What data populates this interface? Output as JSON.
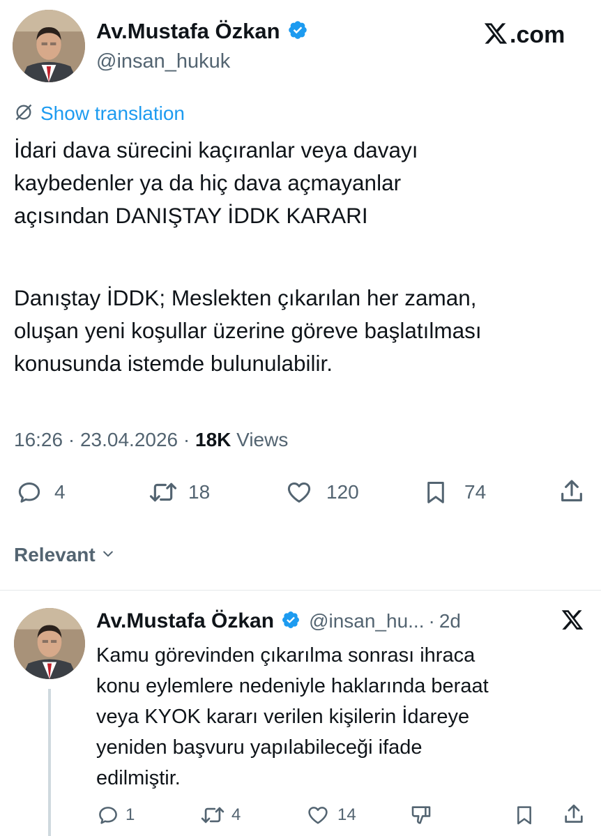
{
  "main_tweet": {
    "author_name": "Av.Mustafa Özkan",
    "author_handle": "@insan_hukuk",
    "site_label": ".com",
    "show_translation": "Show translation",
    "paragraph1": "İdari dava sürecini kaçıranlar veya davayı\nkaybedenler ya da hiç dava açmayanlar\naçısından DANIŞTAY İDDK KARARI",
    "paragraph2": "Danıştay İDDK; Meslekten çıkarılan her zaman,\noluşan yeni koşullar üzerine göreve başlatılması\nkonusunda istemde bulunulabilir.",
    "time": "16:26",
    "separator": "·",
    "date": "23.04.2026",
    "views_count": "18K",
    "views_label": "Views",
    "replies": "4",
    "reposts": "18",
    "likes": "120",
    "bookmarks": "74"
  },
  "sort": {
    "label": "Relevant"
  },
  "reply_tweet": {
    "author_name": "Av.Mustafa Özkan",
    "author_handle": "@insan_hu...",
    "separator": "·",
    "age": "2d",
    "text": "Kamu görevinden çıkarılma sonrası ihraca\nkonu eylemlere nedeniyle haklarında beraat\nveya KYOK kararı verilen kişilerin İdareye\nyeniden başvuru yapılabileceği ifade\nedilmiştir.",
    "replies": "1",
    "reposts": "4",
    "likes": "14"
  },
  "colors": {
    "link_blue": "#1d9bf0",
    "text_dark": "#0f1419",
    "text_gray": "#536471",
    "divider": "#e6e9eb"
  }
}
